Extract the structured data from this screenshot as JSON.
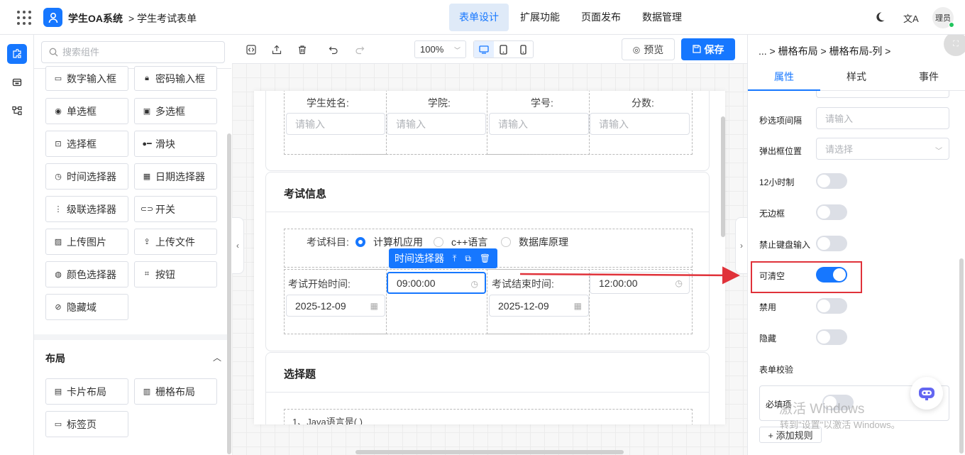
{
  "header": {
    "app_name": "学生OA系统",
    "breadcrumb": "> 学生考试表单",
    "nav": [
      "表单设计",
      "扩展功能",
      "页面发布",
      "数据管理"
    ],
    "nav_active": 0,
    "lang_icon": "文A",
    "avatar_text": "理员",
    "accent": "#1677ff"
  },
  "left_panel": {
    "search_placeholder": "搜索组件",
    "components": [
      "数字输入框",
      "密码输入框",
      "单选框",
      "多选框",
      "选择框",
      "滑块",
      "时间选择器",
      "日期选择器",
      "级联选择器",
      "开关",
      "上传图片",
      "上传文件",
      "颜色选择器",
      "按钮",
      "隐藏域"
    ],
    "layout_title": "布局",
    "layout_items": [
      "卡片布局",
      "栅格布局",
      "标签页"
    ]
  },
  "toolbar": {
    "zoom": "100%",
    "preview_label": "预览",
    "save_label": "保存"
  },
  "form": {
    "student_fields": [
      "学生姓名:",
      "学院:",
      "学号:",
      "分数:"
    ],
    "input_placeholder": "请输入",
    "exam_card_title": "考试信息",
    "subject_label": "考试科目:",
    "subject_options": [
      "计算机应用",
      "c++语言",
      "数据库原理"
    ],
    "subject_selected": 0,
    "start_time_label": "考试开始时间:",
    "start_date": "2025-12-09",
    "start_time": "09:00:00",
    "end_time_label": "考试结束时间:",
    "end_date": "2025-12-09",
    "end_time": "12:00:00",
    "selected_component": "时间选择器",
    "choice_card_title": "选择题",
    "question_1": "1、Java语言是( )"
  },
  "right_panel": {
    "breadcrumb": "... > 栅格布局 > 栅格布局-列 >",
    "tabs": [
      "属性",
      "样式",
      "事件"
    ],
    "tab_active": 0,
    "second_step_label": "秒选项间隔",
    "second_step_placeholder": "请输入",
    "popper_label": "弹出框位置",
    "popper_placeholder": "请选择",
    "toggles": [
      {
        "label": "12小时制",
        "on": false
      },
      {
        "label": "无边框",
        "on": false
      },
      {
        "label": "禁止键盘输入",
        "on": false
      },
      {
        "label": "可清空",
        "on": true
      },
      {
        "label": "禁用",
        "on": false
      },
      {
        "label": "隐藏",
        "on": false
      }
    ],
    "validation_title": "表单校验",
    "required_label": "必填项",
    "add_rule_label": "+ 添加规则"
  },
  "watermark": {
    "line1": "激活 Windows",
    "line2": "转到\"设置\"以激活 Windows。"
  }
}
